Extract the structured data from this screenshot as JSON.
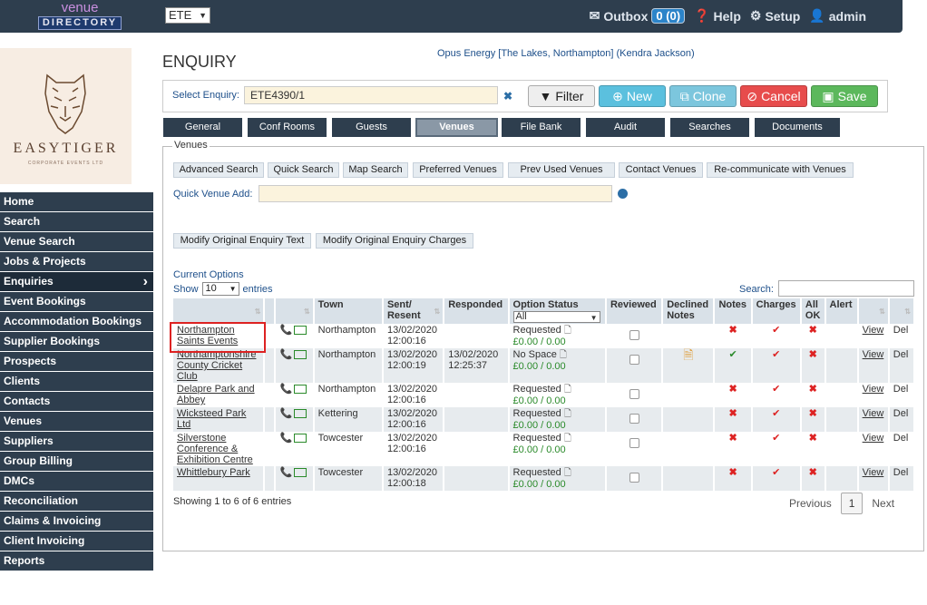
{
  "topbar": {
    "logo_line1": "venue",
    "logo_line2": "DIRECTORY",
    "company_select": "ETE",
    "outbox_label": "Outbox",
    "outbox_count": "0 (0)",
    "help_label": "Help",
    "setup_label": "Setup",
    "user_label": "admin"
  },
  "client_logo": {
    "brand": "EASYTIGER",
    "sub": "CORPORATE EVENTS LTD"
  },
  "sidebar": {
    "items": [
      {
        "label": "Home"
      },
      {
        "label": "Search"
      },
      {
        "label": "Venue Search"
      },
      {
        "label": "Jobs & Projects"
      },
      {
        "label": "Enquiries"
      },
      {
        "label": "Event Bookings"
      },
      {
        "label": "Accommodation Bookings"
      },
      {
        "label": "Supplier Bookings"
      },
      {
        "label": "Prospects"
      },
      {
        "label": "Clients"
      },
      {
        "label": "Contacts"
      },
      {
        "label": "Venues"
      },
      {
        "label": "Suppliers"
      },
      {
        "label": "Group Billing"
      },
      {
        "label": "DMCs"
      },
      {
        "label": "Reconciliation"
      },
      {
        "label": "Claims & Invoicing"
      },
      {
        "label": "Client Invoicing"
      },
      {
        "label": "Reports"
      }
    ]
  },
  "page": {
    "title": "ENQUIRY",
    "header_info": "Opus Energy [The Lakes, Northampton] (Kendra Jackson)"
  },
  "enquiry_bar": {
    "label": "Select Enquiry:",
    "value": "ETE4390/1",
    "filter": "Filter",
    "new": "New",
    "clone": "Clone",
    "cancel": "Cancel",
    "save": "Save"
  },
  "tabs": [
    "General",
    "Conf Rooms",
    "Guests",
    "Venues",
    "File Bank",
    "Audit",
    "Searches",
    "Documents"
  ],
  "venues_panel": {
    "legend": "Venues",
    "buttons": [
      "Advanced Search",
      "Quick Search",
      "Map Search",
      "Preferred Venues",
      "Prev Used Venues",
      "Contact Venues",
      "Re-communicate with Venues"
    ],
    "quick_add_label": "Quick Venue Add:",
    "modify_text": "Modify Original Enquiry Text",
    "modify_charges": "Modify Original Enquiry Charges",
    "current_options": "Current Options",
    "show_label": "Show",
    "show_value": "10",
    "entries_label": "entries",
    "search_label": "Search:"
  },
  "table": {
    "headers": [
      "",
      "",
      "Town",
      "Sent/ Resent",
      "Responded",
      "Option Status",
      "Reviewed",
      "Declined Notes",
      "Notes",
      "Charges",
      "All OK",
      "Alert",
      "",
      ""
    ],
    "status_filter": "All",
    "rows": [
      {
        "venue": "Northampton Saints Events",
        "town": "Northampton",
        "sent": "13/02/2020 12:00:16",
        "responded": "",
        "status": "Requested",
        "amount": "£0.00 / 0.00",
        "declined_note": false,
        "notes": "x",
        "view": "View",
        "del": "Del"
      },
      {
        "venue": "Northamptonshire County Cricket Club",
        "town": "Northampton",
        "sent": "13/02/2020 12:00:19",
        "responded": "13/02/2020 12:25:37",
        "status": "No Space",
        "amount": "£0.00 / 0.00",
        "declined_note": true,
        "notes": "check",
        "view": "View",
        "del": "Del"
      },
      {
        "venue": "Delapre Park and Abbey",
        "town": "Northampton",
        "sent": "13/02/2020 12:00:16",
        "responded": "",
        "status": "Requested",
        "amount": "£0.00 / 0.00",
        "declined_note": false,
        "notes": "x",
        "view": "View",
        "del": "Del"
      },
      {
        "venue": "Wicksteed Park Ltd",
        "town": "Kettering",
        "sent": "13/02/2020 12:00:16",
        "responded": "",
        "status": "Requested",
        "amount": "£0.00 / 0.00",
        "declined_note": false,
        "notes": "x",
        "view": "View",
        "del": "Del"
      },
      {
        "venue": "Silverstone Conference & Exhibition Centre",
        "town": "Towcester",
        "sent": "13/02/2020 12:00:16",
        "responded": "",
        "status": "Requested",
        "amount": "£0.00 / 0.00",
        "declined_note": false,
        "notes": "x",
        "view": "View",
        "del": "Del"
      },
      {
        "venue": "Whittlebury Park",
        "town": "Towcester",
        "sent": "13/02/2020 12:00:18",
        "responded": "",
        "status": "Requested",
        "amount": "£0.00 / 0.00",
        "declined_note": false,
        "notes": "x",
        "view": "View",
        "del": "Del"
      }
    ]
  },
  "footer": {
    "showing": "Showing 1 to 6 of 6 entries",
    "previous": "Previous",
    "page": "1",
    "next": "Next"
  }
}
